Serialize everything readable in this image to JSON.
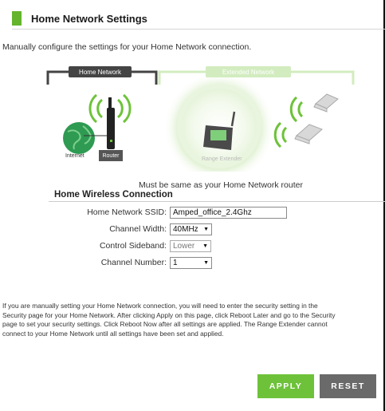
{
  "header": {
    "title": "Home Network Settings"
  },
  "intro": "Manually configure the settings for your Home Network connection.",
  "diagram": {
    "home_label": "Home Network",
    "extended_label": "Extended Network",
    "internet_label": "Internet",
    "router_label": "Router",
    "extender_label": "Range Extender"
  },
  "note": "Must be same as your Home Network router",
  "section": {
    "title": "Home Wireless Connection",
    "ssid_label": "Home Network SSID:",
    "ssid_value": "Amped_office_2.4Ghz",
    "channel_width_label": "Channel Width:",
    "channel_width_value": "40MHz",
    "sideband_label": "Control Sideband:",
    "sideband_value": "Lower",
    "channel_number_label": "Channel Number:",
    "channel_number_value": "1"
  },
  "paragraph": [
    "If you are manually setting your Home Network connection, you will need to enter the security setting in the",
    "Security page for your Home Network. After clicking Apply on this page, click Reboot Later and go to the Security",
    "page to set your security settings. Click Reboot Now after all settings are applied. The Range Extender cannot",
    "connect to your Home Network until all settings have been set and applied."
  ],
  "buttons": {
    "apply": "APPLY",
    "reset": "RESET"
  },
  "colors": {
    "accent": "#64b42d",
    "apply": "#6ec23a",
    "reset": "#6a6a6a"
  }
}
